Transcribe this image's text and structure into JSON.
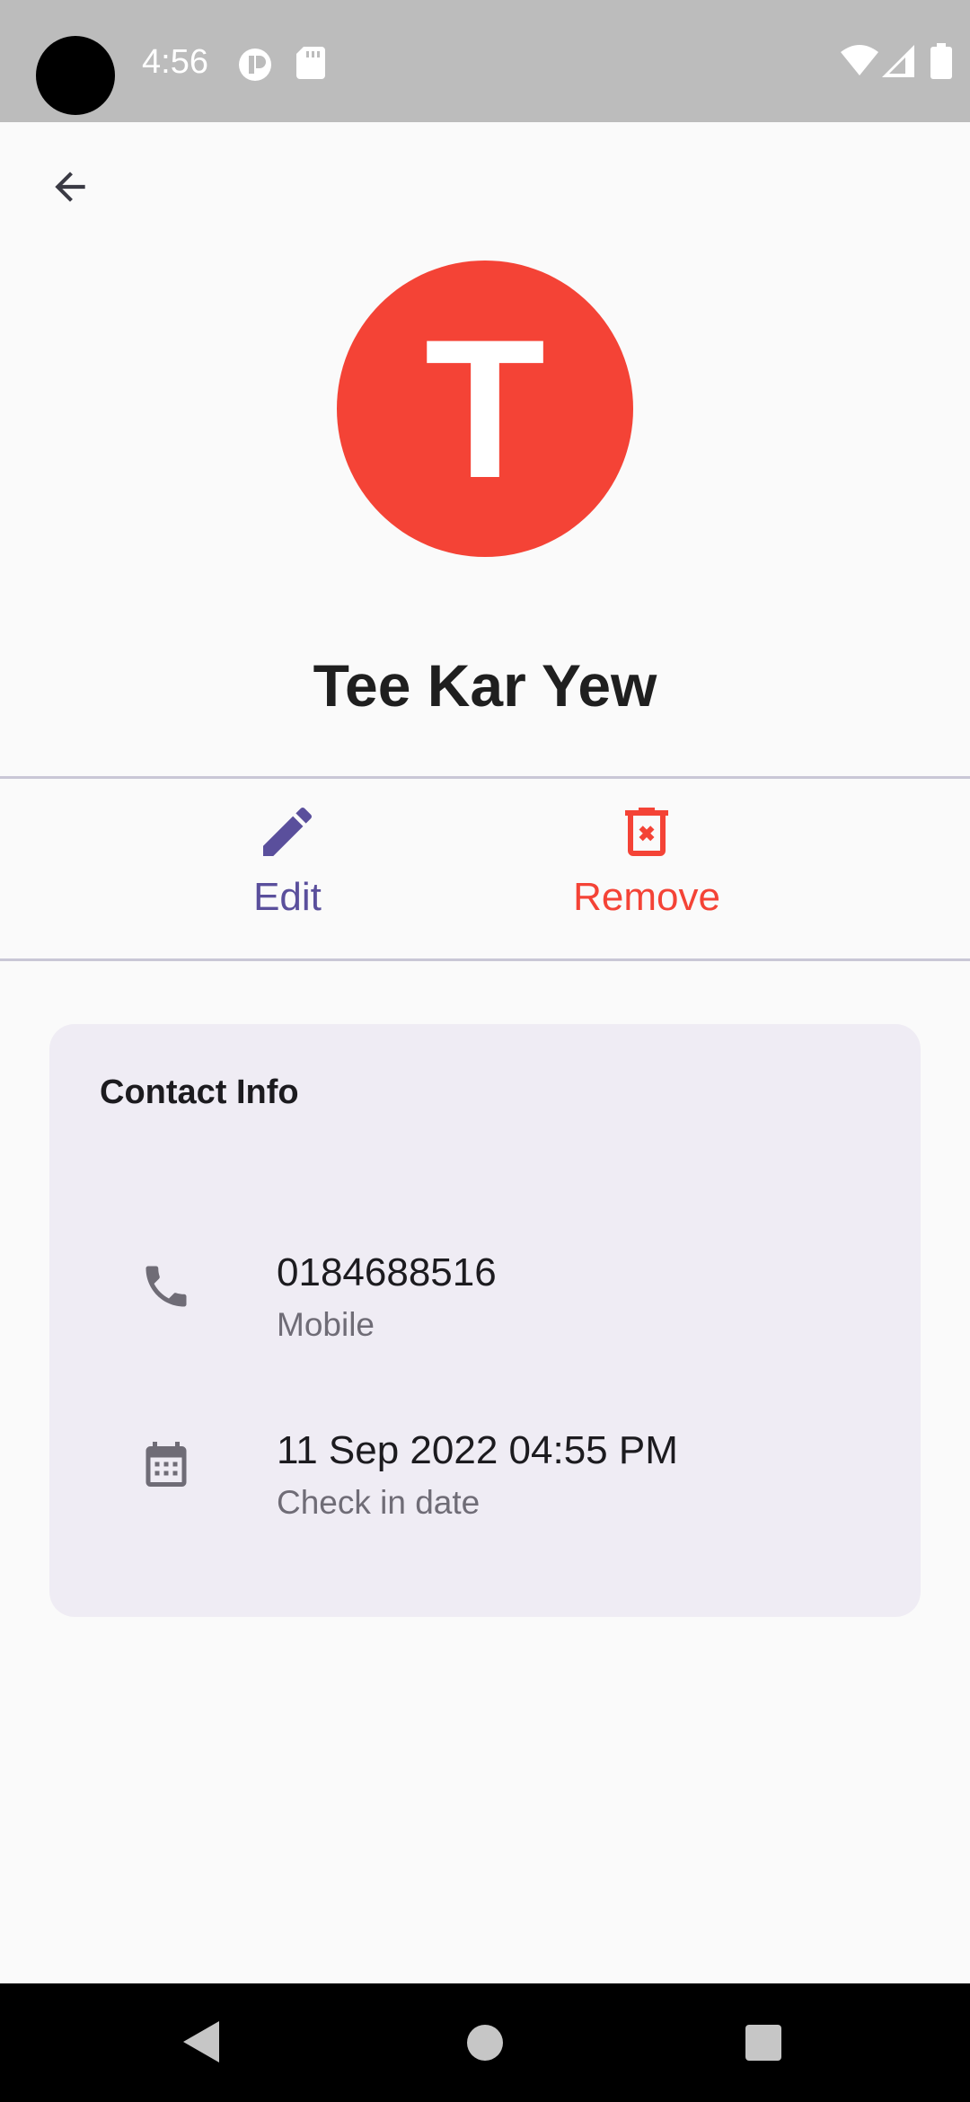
{
  "status_bar": {
    "time": "4:56"
  },
  "app_bar": {
    "back_icon": "arrow-back-icon"
  },
  "contact": {
    "avatar_letter": "T",
    "avatar_color": "#f44336",
    "name": "Tee Kar Yew"
  },
  "actions": {
    "edit_label": "Edit",
    "edit_color": "#5a4f9c",
    "remove_label": "Remove",
    "remove_color": "#f44336"
  },
  "contact_info": {
    "title": "Contact Info",
    "rows": [
      {
        "icon": "phone-icon",
        "value": "0184688516",
        "label": "Mobile"
      },
      {
        "icon": "calendar-icon",
        "value": "11 Sep 2022 04:55 PM",
        "label": "Check in date"
      }
    ]
  },
  "nav_bar": {
    "back": "nav-back-icon",
    "home": "nav-home-icon",
    "recents": "nav-recents-icon"
  }
}
